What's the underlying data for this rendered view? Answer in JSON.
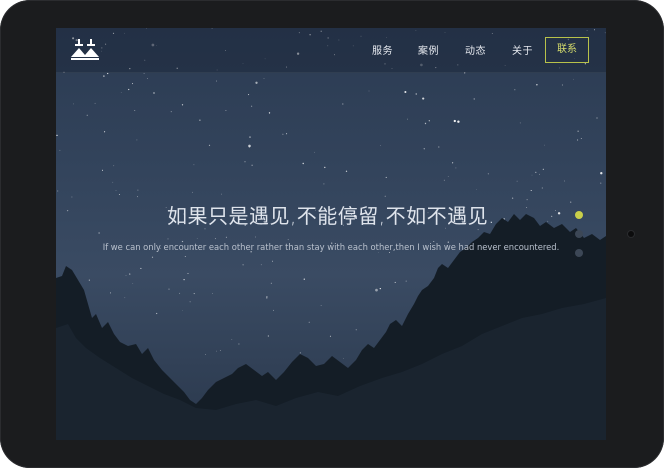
{
  "nav": {
    "items": [
      "服务",
      "案例",
      "动态",
      "关于"
    ],
    "contact": "联系"
  },
  "hero": {
    "headline": "如果只是遇见,不能停留,不如不遇见.",
    "subline": "If we can only encounter each other rather than stay with each other,then I wish we had never encountered."
  },
  "slider": {
    "count": 3,
    "active_index": 0,
    "active_color": "#c9cf4a",
    "inactive_color": "#3c4756"
  },
  "colors": {
    "accent": "#b8c24a",
    "bezel": "#1b1c1e",
    "sky": "#33445c"
  }
}
